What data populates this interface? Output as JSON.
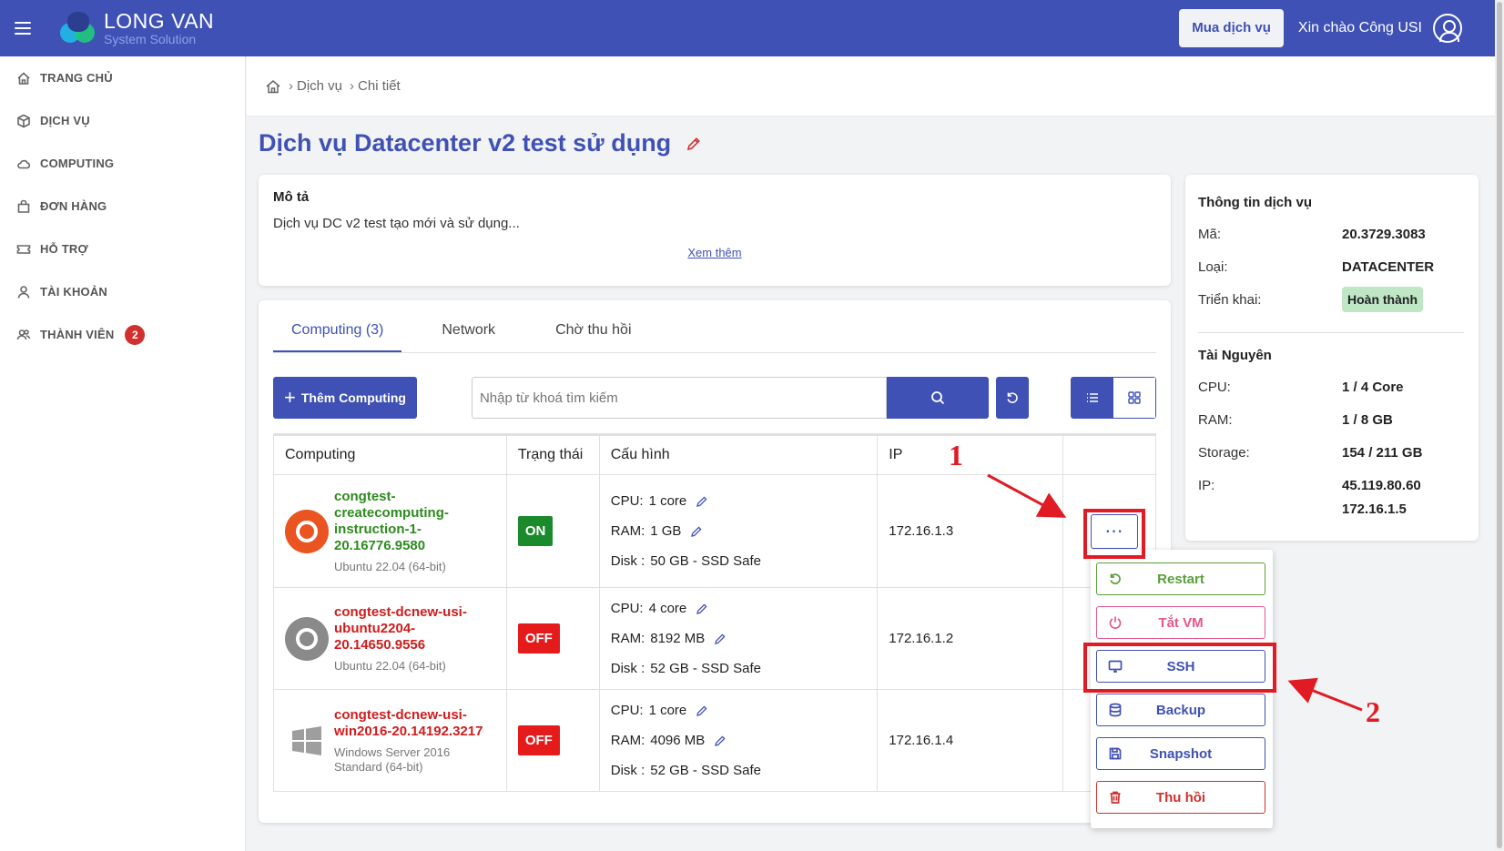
{
  "header": {
    "logo_line1": "LONG VAN",
    "logo_line2": "System Solution",
    "buy_button": "Mua dịch vụ",
    "greeting": "Xin chào Công USI"
  },
  "sidebar": {
    "items": [
      {
        "label": "TRANG CHỦ",
        "icon": "home-icon"
      },
      {
        "label": "DỊCH VỤ",
        "icon": "cube-icon"
      },
      {
        "label": "COMPUTING",
        "icon": "cloud-icon"
      },
      {
        "label": "ĐƠN HÀNG",
        "icon": "bag-icon"
      },
      {
        "label": "HỖ TRỢ",
        "icon": "ticket-icon"
      },
      {
        "label": "TÀI KHOẢN",
        "icon": "user-icon"
      },
      {
        "label": "THÀNH VIÊN",
        "icon": "users-icon",
        "badge": "2"
      }
    ]
  },
  "breadcrumb": {
    "items": [
      "Dịch vụ",
      "Chi tiết"
    ]
  },
  "page_title": "Dịch vụ Datacenter v2 test sử dụng",
  "description": {
    "heading": "Mô tả",
    "text": "Dịch vụ DC v2 test tạo mới và sử dụng...",
    "more_link": "Xem thêm"
  },
  "service_info": {
    "heading": "Thông tin dịch vụ",
    "rows": [
      {
        "key": "Mã:",
        "value": "20.3729.3083"
      },
      {
        "key": "Loại:",
        "value": "DATACENTER"
      },
      {
        "key": "Triển khai:",
        "value": "Hoàn thành"
      }
    ],
    "resources_heading": "Tài Nguyên",
    "resources": [
      {
        "key": "CPU:",
        "value": "1 / 4 Core"
      },
      {
        "key": "RAM:",
        "value": "1 / 8 GB"
      },
      {
        "key": "Storage:",
        "value": "154 / 211 GB"
      },
      {
        "key": "IP:",
        "value": "45.119.80.60"
      },
      {
        "key": "",
        "value": "172.16.1.5"
      }
    ],
    "status_color": "#bfe6c5"
  },
  "tabs": [
    {
      "label": "Computing (3)",
      "active": true
    },
    {
      "label": "Network",
      "active": false
    },
    {
      "label": "Chờ thu hồi",
      "active": false
    }
  ],
  "toolbar": {
    "add_button": "Thêm Computing",
    "search_placeholder": "Nhập từ khoá tìm kiếm"
  },
  "table": {
    "headers": [
      "Computing",
      "Trạng thái",
      "Cấu hình",
      "IP",
      ""
    ],
    "rows": [
      {
        "name": "congtest-createcomputing-instruction-1-20.16776.9580",
        "name_lines": [
          "congtest-",
          "createcomputing-",
          "instruction-1-",
          "20.16776.9580"
        ],
        "os": "Ubuntu 22.04 (64-bit)",
        "os_icon": "ubuntu-icon",
        "status": "ON",
        "cpu": "1 core",
        "ram": "1 GB",
        "disk": "50 GB - SSD Safe",
        "ip": "172.16.1.3"
      },
      {
        "name": "congtest-dcnew-usi-ubuntu2204-20.14650.9556",
        "name_lines": [
          "congtest-dcnew-usi-",
          "ubuntu2204-",
          "20.14650.9556"
        ],
        "os": "Ubuntu 22.04 (64-bit)",
        "os_icon": "ubuntu-grey-icon",
        "status": "OFF",
        "cpu": "4 core",
        "ram": "8192 MB",
        "disk": "52 GB - SSD Safe",
        "ip": "172.16.1.2"
      },
      {
        "name": "congtest-dcnew-usi-win2016-20.14192.3217",
        "name_lines": [
          "congtest-dcnew-usi-",
          "win2016-20.14192.3217"
        ],
        "os": "Windows Server 2016 Standard (64-bit)",
        "os_lines": [
          "Windows Server 2016",
          "Standard (64-bit)"
        ],
        "os_icon": "windows-icon",
        "status": "OFF",
        "cpu": "1 core",
        "ram": "4096 MB",
        "disk": "52 GB - SSD Safe",
        "ip": "172.16.1.4"
      }
    ],
    "labels": {
      "cpu": "CPU:",
      "ram": "RAM:",
      "disk": "Disk :"
    }
  },
  "action_menu": {
    "items": [
      {
        "label": "Restart",
        "color": "#5a9e3a",
        "icon": "restart-icon"
      },
      {
        "label": "Tắt VM",
        "color": "#e4578a",
        "icon": "power-icon"
      },
      {
        "label": "SSH",
        "color": "#3f51b5",
        "icon": "monitor-icon"
      },
      {
        "label": "Backup",
        "color": "#3f51b5",
        "icon": "database-icon"
      },
      {
        "label": "Snapshot",
        "color": "#3f51b5",
        "icon": "save-icon"
      },
      {
        "label": "Thu hồi",
        "color": "#d32f2f",
        "icon": "trash-icon"
      }
    ]
  },
  "annotations": {
    "label_1": "1",
    "label_2": "2",
    "color": "#e01b24"
  },
  "colors": {
    "primary": "#3f51b5",
    "on": "#1b8a2d",
    "off": "#e51b1b"
  }
}
